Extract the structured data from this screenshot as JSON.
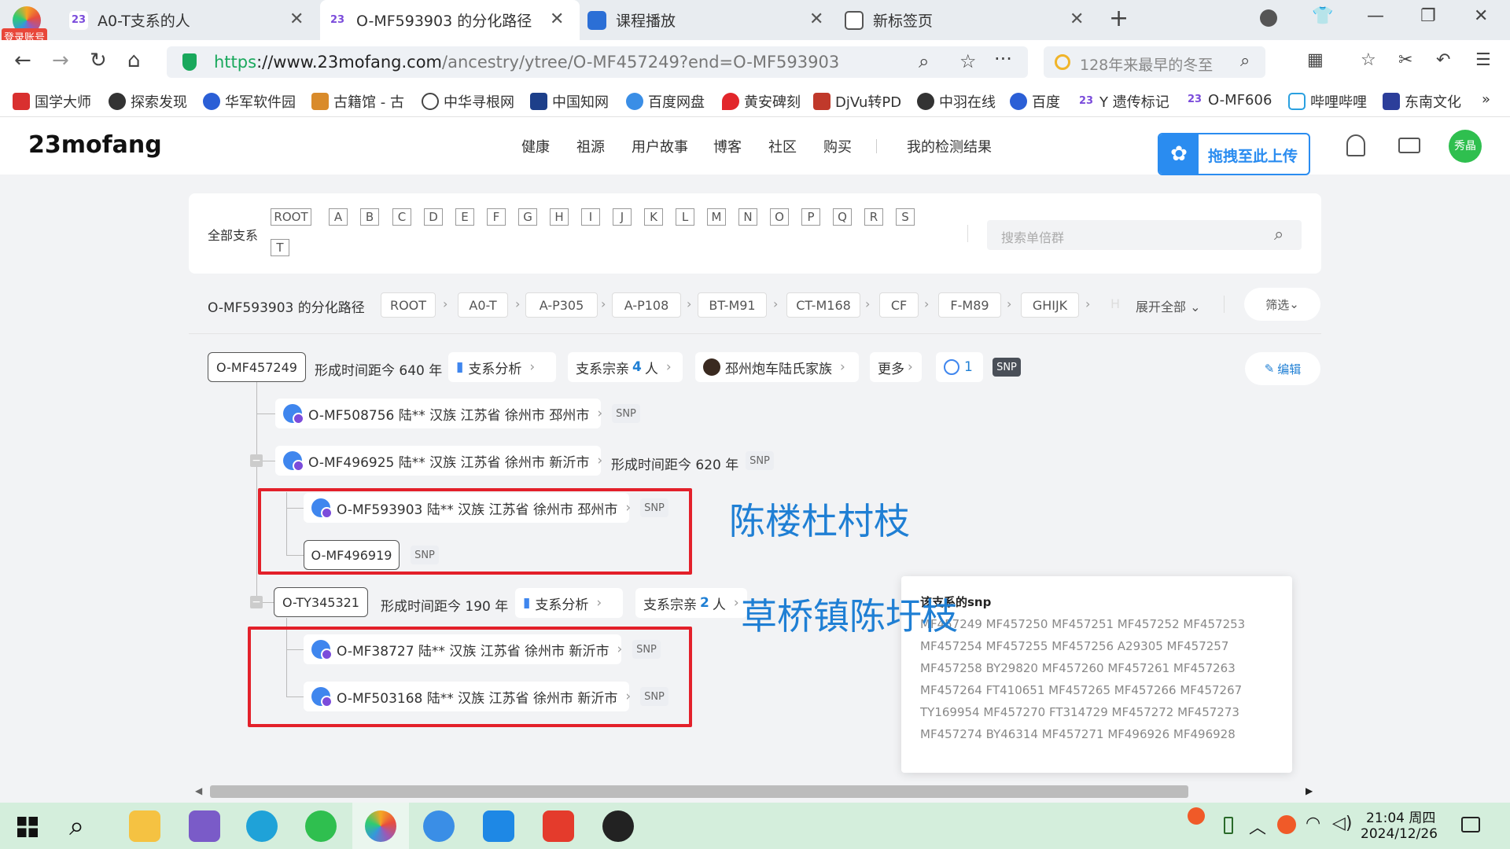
{
  "browser": {
    "login_badge": "登录账号",
    "tabs": [
      {
        "title": "A0-T支系的人",
        "active": false
      },
      {
        "title": "O-MF593903 的分化路径",
        "active": true
      },
      {
        "title": "课程播放",
        "active": false
      },
      {
        "title": "新标签页",
        "active": false
      }
    ],
    "url": {
      "scheme": "https",
      "host": "://www.23mofang.com",
      "path": "/ancestry/ytree/O-MF457249?end=O-MF593903"
    },
    "search_placeholder": "128年来最早的冬至",
    "bookmarks": [
      "国学大师",
      "探索发现",
      "华军软件园",
      "古籍馆 - 古",
      "中华寻根网",
      "中国知网",
      "百度网盘",
      "黄安碑刻",
      "DjVu转PD",
      "中羽在线",
      "百度",
      "Y 遗传标记",
      "O-MF606",
      "哔哩哔哩",
      "东南文化"
    ],
    "more_bookmarks": "»"
  },
  "site": {
    "logo": "23mofang",
    "nav": [
      "健康",
      "祖源",
      "用户故事",
      "博客",
      "社区",
      "购买",
      "我的检测结果"
    ],
    "upload_label": "拖拽至此上传",
    "avatar_text": "秀晶"
  },
  "filter": {
    "label": "全部支系",
    "letters": [
      "ROOT",
      "A",
      "B",
      "C",
      "D",
      "E",
      "F",
      "G",
      "H",
      "I",
      "J",
      "K",
      "L",
      "M",
      "N",
      "O",
      "P",
      "Q",
      "R",
      "S",
      "T"
    ],
    "search_placeholder": "搜索单倍群"
  },
  "path": {
    "title": "O-MF593903 的分化路径",
    "crumbs": [
      "ROOT",
      "A0-T",
      "A-P305",
      "A-P108",
      "BT-M91",
      "CT-M168",
      "CF",
      "F-M89",
      "GHIJK"
    ],
    "crumb_faded": "H",
    "expand_all": "展开全部",
    "filter_btn": "筛选"
  },
  "tree": {
    "root": {
      "id": "O-MF457249",
      "age": "形成时间距今 640 年",
      "analysis": "支系分析",
      "clan_prefix": "支系宗亲",
      "clan_count": "4",
      "clan_suffix": "人",
      "family": "邳州炮车陆氏家族",
      "more": "更多",
      "comments": "1",
      "snp": "SNP",
      "edit": "编辑"
    },
    "n1": {
      "text": "O-MF508756 陆** 汉族 江苏省 徐州市 邳州市",
      "snp": "SNP"
    },
    "n2": {
      "text": "O-MF496925 陆** 汉族 江苏省 徐州市 新沂市",
      "age": "形成时间距今 620 年",
      "snp": "SNP"
    },
    "n3": {
      "text": "O-MF593903 陆** 汉族 江苏省 徐州市 邳州市",
      "snp": "SNP"
    },
    "n4": {
      "id": "O-MF496919",
      "snp": "SNP"
    },
    "n5": {
      "id": "O-TY345321",
      "age": "形成时间距今 190 年",
      "analysis": "支系分析",
      "clan_prefix": "支系宗亲",
      "clan_count": "2",
      "clan_suffix": "人"
    },
    "n6": {
      "text": "O-MF38727 陆** 汉族 江苏省 徐州市 新沂市",
      "snp": "SNP"
    },
    "n7": {
      "text": "O-MF503168 陆** 汉族 江苏省 徐州市 新沂市",
      "snp": "SNP"
    }
  },
  "annotations": {
    "a1": "陈楼杜村枝",
    "a2": "草桥镇陈圩枝"
  },
  "snp_popup": {
    "title": "该支系的snp",
    "lines": [
      "MF457249 MF457250 MF457251 MF457252 MF457253",
      "MF457254 MF457255 MF457256 A29305 MF457257",
      "MF457258 BY29820 MF457260 MF457261 MF457263",
      "MF457264 FT410651 MF457265 MF457266 MF457267",
      "TY169954 MF457270 FT314729 MF457272 MF457273",
      "MF457274 BY46314 MF457271 MF496926 MF496928"
    ]
  },
  "taskbar": {
    "time": "21:04 周四",
    "date": "2024/12/26"
  },
  "colors": {
    "accent_blue": "#1f7fd4",
    "annotation_red": "#e3202a",
    "taskbar_bg": "#d4eedc",
    "upload_blue": "#2a8cf0"
  }
}
